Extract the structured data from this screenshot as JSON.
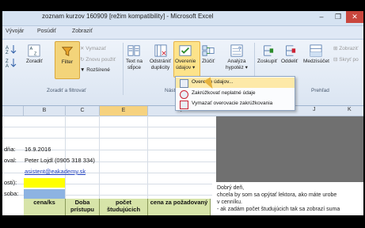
{
  "window": {
    "title": "zoznam kurzov 160909  [režim kompatibility]  -  Microsoft Excel",
    "minimize": "–",
    "restore": "❐",
    "close": "✕"
  },
  "menu_tabs": [
    "Vývojár",
    "Posúdiť",
    "Zobraziť"
  ],
  "ribbon": {
    "sort_group": {
      "label": "Zoradiť a filtrovať",
      "sort_btn": "Zoradiť",
      "filter_btn": "Filter",
      "clear_btn": "Vymazať",
      "reapply_btn": "Znovu použiť",
      "advanced_btn": "Rozšírené"
    },
    "data_tools_group": {
      "label": "Nást",
      "text_to_cols_btn1": "Text na",
      "text_to_cols_btn2": "stĺpce",
      "remove_dup_btn1": "Odstrániť",
      "remove_dup_btn2": "duplicity",
      "validation_btn1": "Overenie",
      "validation_btn2": "údajov ▾",
      "consolidate_btn": "Zlúčiť",
      "whatif_btn1": "Analýza",
      "whatif_btn2": "hypotéz ▾"
    },
    "outline_group": {
      "label": "Prehľad",
      "group_btn": "Zoskupiť",
      "ungroup_btn": "Oddeliť",
      "subtotal_btn": "Medzisúčet",
      "show_detail": "Zobraziť",
      "hide_detail": "Skryť po"
    }
  },
  "dropdown": {
    "items": [
      "Overenie údajov...",
      "Zakrúžkovať neplatné údaje",
      "Vymazať overovacie zakrúžkovania"
    ]
  },
  "sheet": {
    "columns": [
      "B",
      "C",
      "E",
      "F"
    ],
    "right_columns": [
      "J",
      "K"
    ],
    "rows": {
      "r1_label": "dňa:",
      "r1_value": "16.9.2016",
      "r2_label": "oval:",
      "r2_value": "Peter Lojdl (0905 318 334)",
      "r3_value": "asistent@eakademy.sk",
      "r4_label": "osti):",
      "r5_label": "soba:"
    },
    "table_headers": [
      "cena/ks",
      "Doba prístupu",
      "počet študujúcich",
      "cena za požadovaný"
    ]
  },
  "note": {
    "lines": [
      "Dobrý deň,",
      "chcela by som sa opýtať lektora, ako máte urobe",
      "v cenníku.",
      "- ak zadám počet študujúcich tak sa zobrazí suma"
    ]
  },
  "colors": {
    "highlight": "#fde38a",
    "selected_col": "#f6d27f",
    "table_header": "#d7e4a9",
    "yellow_cell": "#ffff00",
    "blue_cell": "#8db3e2"
  }
}
